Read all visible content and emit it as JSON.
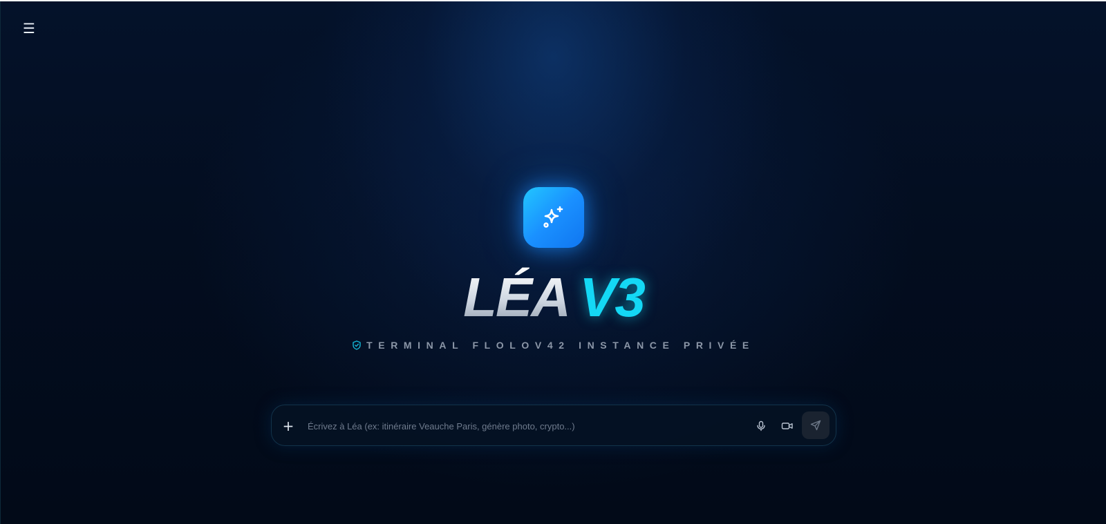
{
  "header": {
    "menu_icon": "hamburger-menu-icon",
    "menu_glyph": "☰"
  },
  "hero": {
    "logo_icon": "sparkles-icon",
    "title_main": "LÉA",
    "title_accent": "V3",
    "subtitle_icon": "shield-check-icon",
    "subtitle": "TERMINAL FLOLOV42 INSTANCE PRIVÉE"
  },
  "composer": {
    "attach_glyph": "+",
    "placeholder": "Écrivez à Léa (ex: itinéraire Veauche Paris, génère photo, crypto...)",
    "value": "",
    "mic_icon": "microphone-icon",
    "video_icon": "video-camera-icon",
    "send_icon": "send-icon"
  },
  "colors": {
    "background": "#030d1f",
    "accent_cyan": "#14d8f5",
    "logo_blue": "#1a90ff",
    "subtitle_gray": "#8c97a8"
  }
}
